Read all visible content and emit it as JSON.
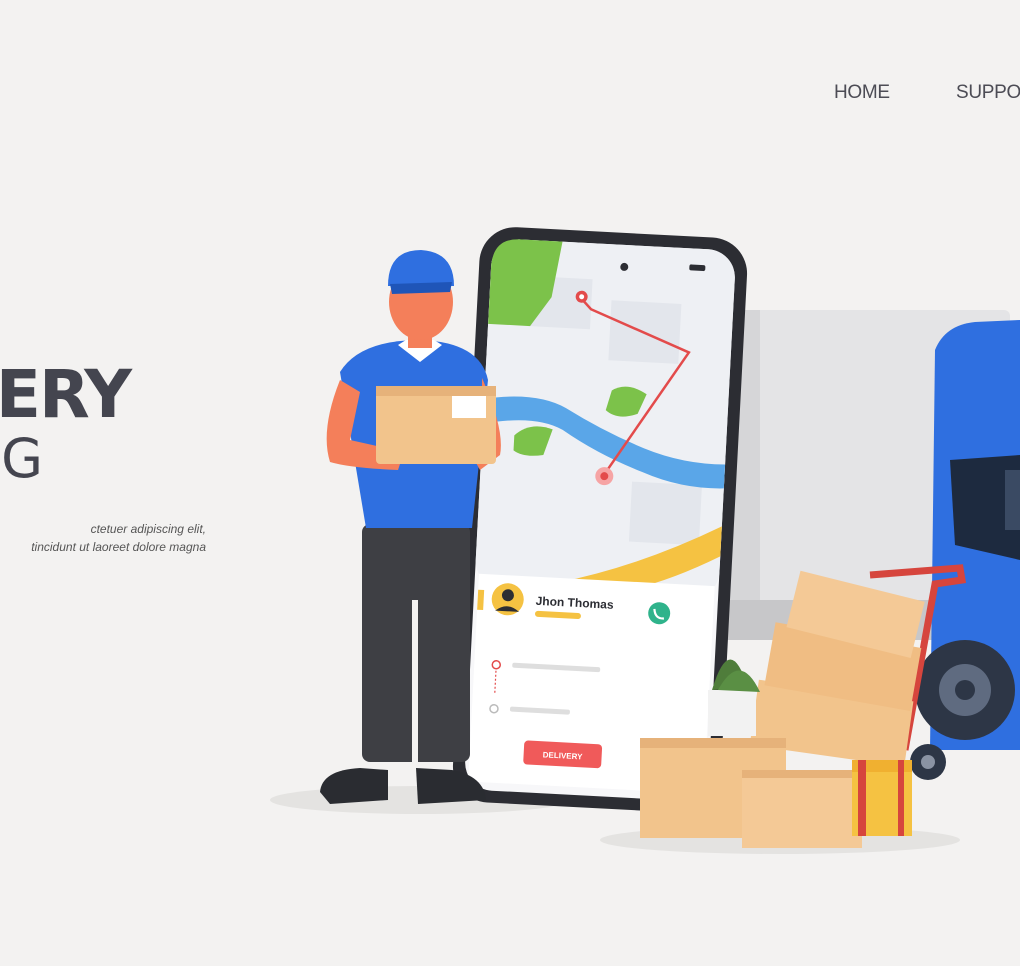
{
  "nav": {
    "items": [
      {
        "label": "HOME"
      },
      {
        "label": "SUPPO"
      }
    ]
  },
  "hero": {
    "title_fragment": "ERY",
    "subtitle_fragment": "G",
    "description_lines": [
      "ctetuer adipiscing elit,",
      "tincidunt ut laoreet dolore magna"
    ]
  },
  "phone_app": {
    "driver_name": "Jhon Thomas",
    "button_label": "DELIVERY"
  },
  "colors": {
    "background": "#f3f2f1",
    "text_dark": "#44454f",
    "accent_blue": "#2f6fe0",
    "route_red": "#e34b4b",
    "box_tan": "#f2c48c",
    "map_green": "#7cc24a",
    "map_river": "#5aa6e8",
    "button_red": "#f05a5a"
  },
  "icons": {
    "driver_avatar": "avatar-icon",
    "call": "phone-call-icon",
    "location_pin": "location-pin-icon"
  }
}
